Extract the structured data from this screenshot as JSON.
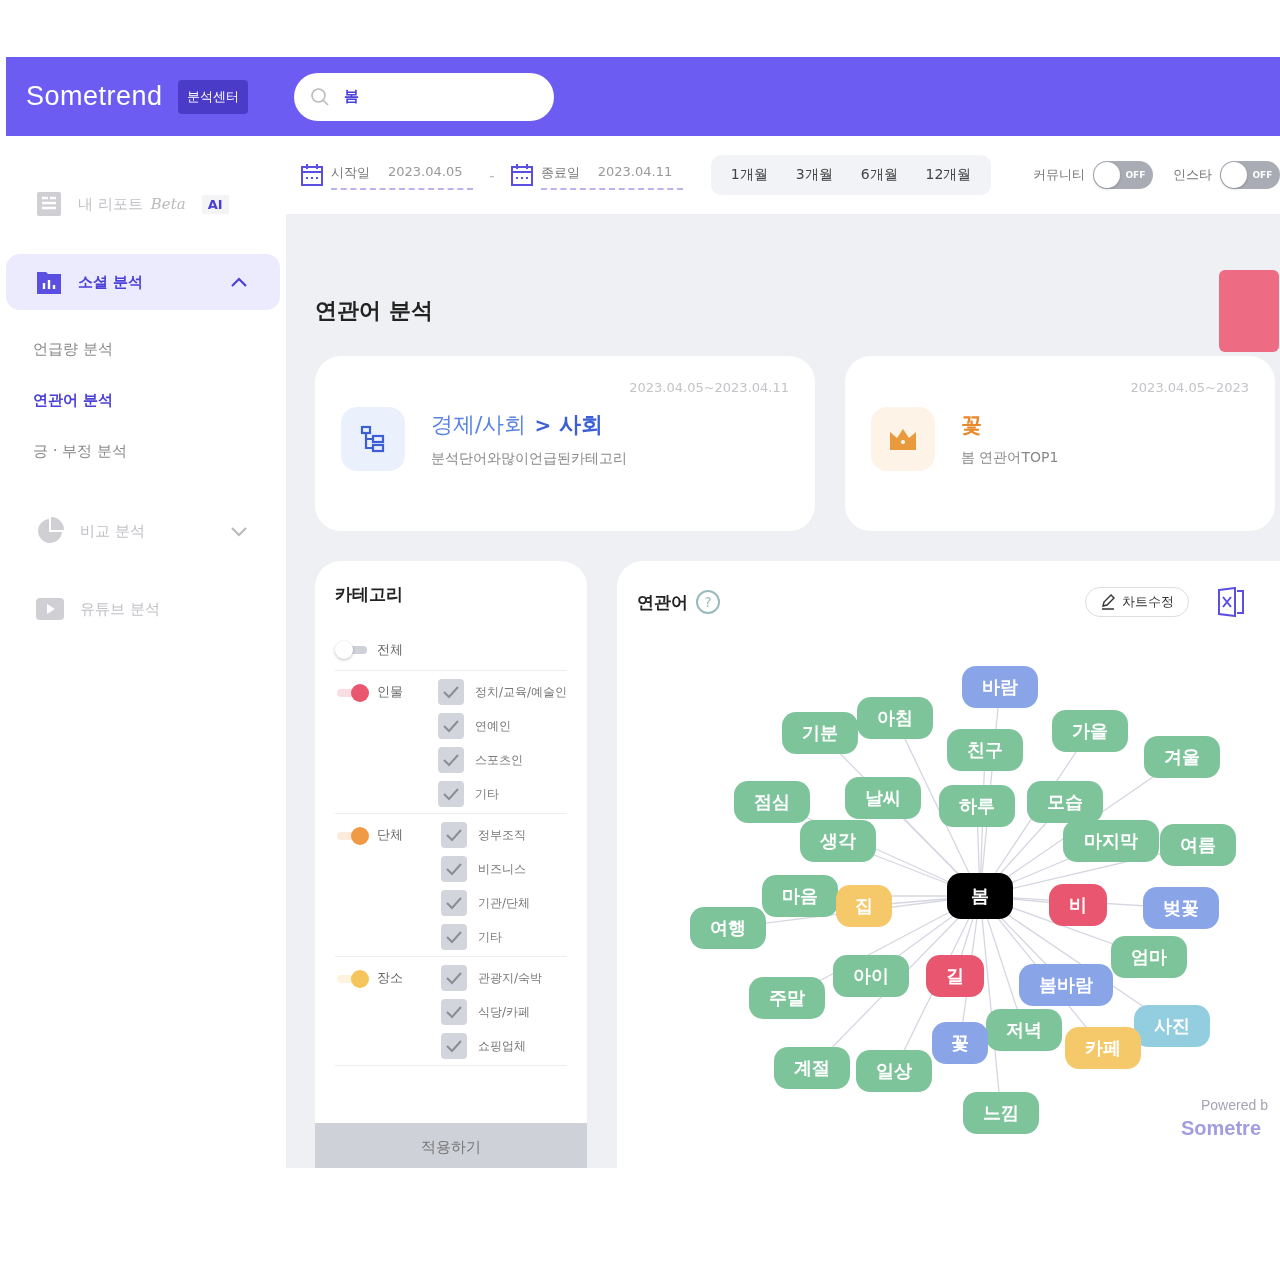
{
  "header": {
    "logo": "Sometrend",
    "badge": "분석센터",
    "search": {
      "value": "봄"
    }
  },
  "sidebar": {
    "items": [
      {
        "kind": "link",
        "label": "내 리포트",
        "tag": "Beta",
        "badge": "AI",
        "selected": false
      },
      {
        "kind": "group",
        "label": "소셜 분석",
        "selected": true,
        "expanded": true,
        "children": [
          {
            "label": "언급량 분석",
            "selected": false
          },
          {
            "label": "연관어 분석",
            "selected": true
          },
          {
            "label": "긍 · 부정 분석",
            "selected": false
          }
        ]
      },
      {
        "kind": "group",
        "label": "비교 분석",
        "selected": false,
        "expanded": false
      },
      {
        "kind": "link",
        "label": "유튜브 분석",
        "selected": false
      }
    ]
  },
  "filters": {
    "start": {
      "label": "시작일",
      "value": "2023.04.05"
    },
    "separator": "-",
    "end": {
      "label": "종료일",
      "value": "2023.04.11"
    },
    "periods": [
      {
        "label": "1개월",
        "selected": false
      },
      {
        "label": "3개월",
        "selected": false
      },
      {
        "label": "6개월",
        "selected": false
      },
      {
        "label": "12개월",
        "selected": false
      }
    ],
    "sources": [
      {
        "label": "커뮤니티",
        "on": false,
        "state_text": "OFF"
      },
      {
        "label": "인스타",
        "on": false,
        "state_text": "OFF"
      }
    ]
  },
  "page_title": "연관어 분석",
  "summary_cards": [
    {
      "kind": "category",
      "date_range": "2023.04.05~2023.04.11",
      "path": "경제/사회",
      "separator": ">",
      "leaf": "사회",
      "caption": "분석단어와많이언급된카테고리"
    },
    {
      "kind": "top",
      "date_range": "2023.04.05~2023",
      "word": "꽃",
      "caption": "봄 연관어TOP1"
    }
  ],
  "category_panel": {
    "title": "카테고리",
    "all": {
      "label": "전체",
      "on": false
    },
    "groups": [
      {
        "label": "인물",
        "on": true,
        "color": "#e8566f",
        "items": [
          {
            "label": "정치/교육/예술인",
            "checked": true
          },
          {
            "label": "연예인",
            "checked": true
          },
          {
            "label": "스포츠인",
            "checked": true
          },
          {
            "label": "기타",
            "checked": true
          }
        ]
      },
      {
        "label": "단체",
        "on": true,
        "color": "#f09a45",
        "items": [
          {
            "label": "정부조직",
            "checked": true
          },
          {
            "label": "비즈니스",
            "checked": true
          },
          {
            "label": "기관/단체",
            "checked": true
          },
          {
            "label": "기타",
            "checked": true
          }
        ]
      },
      {
        "label": "장소",
        "on": true,
        "color": "#f5c45a",
        "items": [
          {
            "label": "관광지/숙박",
            "checked": true
          },
          {
            "label": "식당/카페",
            "checked": true
          },
          {
            "label": "쇼핑업체",
            "checked": true
          }
        ]
      }
    ],
    "apply_button": "적용하기"
  },
  "network": {
    "title": "연관어",
    "help": "?",
    "edit_button": "차트수정",
    "center": "봄",
    "nodes": [
      {
        "label": "바람",
        "color": "#8aa4e8"
      },
      {
        "label": "아침",
        "color": "#7dc49a"
      },
      {
        "label": "기분",
        "color": "#7dc49a"
      },
      {
        "label": "친구",
        "color": "#7dc49a"
      },
      {
        "label": "가을",
        "color": "#7dc49a"
      },
      {
        "label": "겨울",
        "color": "#7dc49a"
      },
      {
        "label": "점심",
        "color": "#7dc49a"
      },
      {
        "label": "날씨",
        "color": "#7dc49a"
      },
      {
        "label": "하루",
        "color": "#7dc49a"
      },
      {
        "label": "모습",
        "color": "#7dc49a"
      },
      {
        "label": "생각",
        "color": "#7dc49a"
      },
      {
        "label": "마지막",
        "color": "#7dc49a"
      },
      {
        "label": "여름",
        "color": "#7dc49a"
      },
      {
        "label": "마음",
        "color": "#7dc49a"
      },
      {
        "label": "집",
        "color": "#f5c96a"
      },
      {
        "label": "비",
        "color": "#e8566f"
      },
      {
        "label": "벚꽃",
        "color": "#8aa4e8"
      },
      {
        "label": "여행",
        "color": "#7dc49a"
      },
      {
        "label": "엄마",
        "color": "#7dc49a"
      },
      {
        "label": "아이",
        "color": "#7dc49a"
      },
      {
        "label": "길",
        "color": "#e8566f"
      },
      {
        "label": "봄바람",
        "color": "#8aa4e8"
      },
      {
        "label": "주말",
        "color": "#7dc49a"
      },
      {
        "label": "사진",
        "color": "#92cde0"
      },
      {
        "label": "저녁",
        "color": "#7dc49a"
      },
      {
        "label": "꽃",
        "color": "#8aa4e8"
      },
      {
        "label": "카페",
        "color": "#f5c96a"
      },
      {
        "label": "계절",
        "color": "#7dc49a"
      },
      {
        "label": "일상",
        "color": "#7dc49a"
      },
      {
        "label": "느낌",
        "color": "#7dc49a"
      }
    ],
    "credit": "Powered b",
    "credit_logo": "Sometre"
  }
}
